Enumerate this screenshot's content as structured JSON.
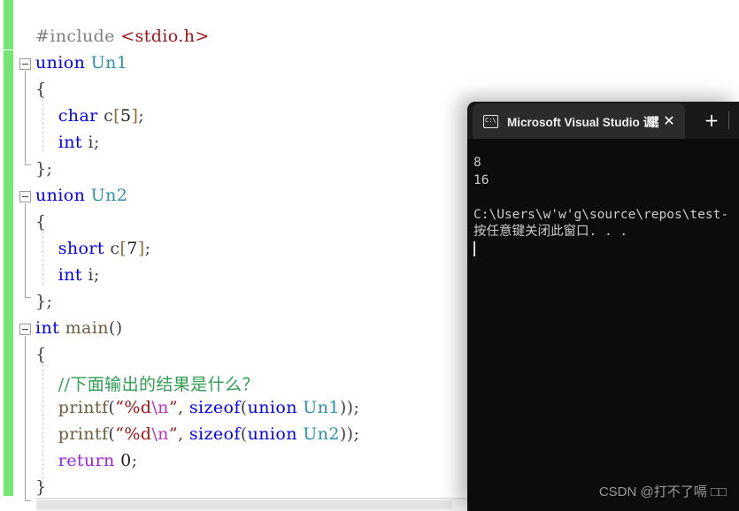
{
  "editor": {
    "name": "visual-studio-code-editor",
    "colors": {
      "change_bar_green": "#73e673",
      "keyword_blue": "#0000ff",
      "type_teal": "#2b91af",
      "string_red": "#a31515",
      "comment_green": "#2e9e4f",
      "control_purple": "#a020f0",
      "escape_magenta": "#c030c0",
      "preprocessor_gray": "#808080",
      "background": "#ffffff"
    },
    "lines": [
      {
        "indent": 0,
        "fold": false,
        "tokens": [
          {
            "t": "#include ",
            "c": "tok-pre"
          },
          {
            "t": "<stdio.h>",
            "c": "tok-str-red"
          }
        ]
      },
      {
        "indent": 0,
        "fold": true,
        "tokens": [
          {
            "t": "union ",
            "c": "tok-kw"
          },
          {
            "t": "Un1",
            "c": "tok-type"
          }
        ]
      },
      {
        "indent": 0,
        "fold": false,
        "tokens": [
          {
            "t": "{",
            "c": "tok-punct"
          }
        ]
      },
      {
        "indent": 0,
        "fold": false,
        "tokens": [
          {
            "t": "    ",
            "c": "tok-plain"
          },
          {
            "t": "char",
            "c": "tok-kw"
          },
          {
            "t": " c",
            "c": "tok-plain"
          },
          {
            "t": "[",
            "c": "tok-brkt1"
          },
          {
            "t": "5",
            "c": "tok-num"
          },
          {
            "t": "]",
            "c": "tok-brkt1"
          },
          {
            "t": ";",
            "c": "tok-plain"
          }
        ]
      },
      {
        "indent": 0,
        "fold": false,
        "tokens": [
          {
            "t": "    ",
            "c": "tok-plain"
          },
          {
            "t": "int",
            "c": "tok-kw"
          },
          {
            "t": " i;",
            "c": "tok-plain"
          }
        ]
      },
      {
        "indent": 0,
        "fold": false,
        "tokens": [
          {
            "t": "};",
            "c": "tok-punct"
          }
        ]
      },
      {
        "indent": 0,
        "fold": true,
        "tokens": [
          {
            "t": "union ",
            "c": "tok-kw"
          },
          {
            "t": "Un2",
            "c": "tok-type"
          }
        ]
      },
      {
        "indent": 0,
        "fold": false,
        "tokens": [
          {
            "t": "{",
            "c": "tok-punct"
          }
        ]
      },
      {
        "indent": 0,
        "fold": false,
        "tokens": [
          {
            "t": "    ",
            "c": "tok-plain"
          },
          {
            "t": "short",
            "c": "tok-kw"
          },
          {
            "t": " c",
            "c": "tok-plain"
          },
          {
            "t": "[",
            "c": "tok-brkt1"
          },
          {
            "t": "7",
            "c": "tok-num"
          },
          {
            "t": "]",
            "c": "tok-brkt1"
          },
          {
            "t": ";",
            "c": "tok-plain"
          }
        ]
      },
      {
        "indent": 0,
        "fold": false,
        "tokens": [
          {
            "t": "    ",
            "c": "tok-plain"
          },
          {
            "t": "int",
            "c": "tok-kw"
          },
          {
            "t": " i;",
            "c": "tok-plain"
          }
        ]
      },
      {
        "indent": 0,
        "fold": false,
        "tokens": [
          {
            "t": "};",
            "c": "tok-punct"
          }
        ]
      },
      {
        "indent": 0,
        "fold": true,
        "tokens": [
          {
            "t": "int",
            "c": "tok-kw"
          },
          {
            "t": " ",
            "c": "tok-plain"
          },
          {
            "t": "main",
            "c": "tok-fn"
          },
          {
            "t": "()",
            "c": "tok-plain"
          }
        ]
      },
      {
        "indent": 0,
        "fold": false,
        "tokens": [
          {
            "t": "{",
            "c": "tok-punct"
          }
        ]
      },
      {
        "indent": 0,
        "fold": false,
        "tokens": [
          {
            "t": "    ",
            "c": "tok-plain"
          },
          {
            "t": "//下面输出的结果是什么？",
            "c": "tok-comment"
          }
        ]
      },
      {
        "indent": 0,
        "fold": false,
        "tokens": [
          {
            "t": "    ",
            "c": "tok-plain"
          },
          {
            "t": "printf",
            "c": "tok-fn"
          },
          {
            "t": "(",
            "c": "tok-plain"
          },
          {
            "t": "“%d",
            "c": "tok-str-red"
          },
          {
            "t": "\\n",
            "c": "tok-escape"
          },
          {
            "t": "”",
            "c": "tok-str-red"
          },
          {
            "t": ", ",
            "c": "tok-plain"
          },
          {
            "t": "sizeof",
            "c": "tok-kw"
          },
          {
            "t": "(",
            "c": "tok-plain"
          },
          {
            "t": "union ",
            "c": "tok-kw"
          },
          {
            "t": "Un1",
            "c": "tok-type"
          },
          {
            "t": "));",
            "c": "tok-plain"
          }
        ]
      },
      {
        "indent": 0,
        "fold": false,
        "tokens": [
          {
            "t": "    ",
            "c": "tok-plain"
          },
          {
            "t": "printf",
            "c": "tok-fn"
          },
          {
            "t": "(",
            "c": "tok-plain"
          },
          {
            "t": "“%d",
            "c": "tok-str-red"
          },
          {
            "t": "\\n",
            "c": "tok-escape"
          },
          {
            "t": "”",
            "c": "tok-str-red"
          },
          {
            "t": ", ",
            "c": "tok-plain"
          },
          {
            "t": "sizeof",
            "c": "tok-kw"
          },
          {
            "t": "(",
            "c": "tok-plain"
          },
          {
            "t": "union ",
            "c": "tok-kw"
          },
          {
            "t": "Un2",
            "c": "tok-type"
          },
          {
            "t": "));",
            "c": "tok-plain"
          }
        ]
      },
      {
        "indent": 0,
        "fold": false,
        "tokens": [
          {
            "t": "    ",
            "c": "tok-plain"
          },
          {
            "t": "return",
            "c": "tok-ctrl"
          },
          {
            "t": " ",
            "c": "tok-plain"
          },
          {
            "t": "0",
            "c": "tok-num"
          },
          {
            "t": ";",
            "c": "tok-plain"
          }
        ]
      },
      {
        "indent": 0,
        "fold": false,
        "tokens": [
          {
            "t": "}",
            "c": "tok-punct"
          }
        ]
      }
    ]
  },
  "console": {
    "tab": {
      "title_ascii": "Microsoft Visual Studio ",
      "title_cjk": "调试控",
      "icon_name": "console-icon",
      "close_label": "✕",
      "new_tab_label": "+",
      "chevron_label": "⌄"
    },
    "output_lines": [
      "8",
      "16",
      "",
      "C:\\Users\\w'w'g\\source\\repos\\test-",
      "按任意键关闭此窗口. . ."
    ]
  },
  "watermark": {
    "text": "CSDN @打不了嗝 □□"
  }
}
